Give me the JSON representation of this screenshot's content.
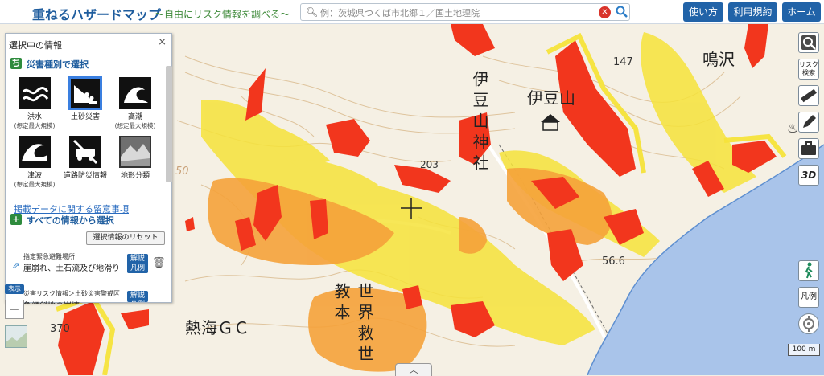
{
  "header": {
    "title": "重ねるハザードマップ",
    "subtitle": "～自由にリスク情報を調べる～",
    "search": {
      "placeholder": "例：茨城県つくば市北郷１／国土地理院",
      "clear_icon": "close-icon",
      "search_icon": "magnifier-icon"
    },
    "buttons": {
      "howto": "使い方",
      "terms": "利用規約",
      "home": "ホーム"
    }
  },
  "colors": {
    "brand": "#1f5d9e",
    "button": "#2163a8",
    "hazard_red": "#f2361d",
    "hazard_yellow": "#f6e33a",
    "hazard_orange": "#f5a23a",
    "sea": "#a9c4ea"
  },
  "panel": {
    "title": "選択中の情報",
    "close": "×",
    "by_type_header": "災害種別で選択",
    "hazards": [
      {
        "label": "洪水",
        "sub": "(想定最大規模)",
        "icon": "flood-icon",
        "selected": false
      },
      {
        "label": "土砂災害",
        "sub": "",
        "icon": "landslide-icon",
        "selected": true
      },
      {
        "label": "高潮",
        "sub": "(想定最大規模)",
        "icon": "storm-surge-icon",
        "selected": false
      },
      {
        "label": "津波",
        "sub": "(想定最大規模)",
        "icon": "tsunami-icon",
        "selected": false
      },
      {
        "label": "道路防災情報",
        "sub": "",
        "icon": "road-closed-icon",
        "selected": false
      },
      {
        "label": "地形分類",
        "sub": "",
        "icon": "terrain-icon",
        "selected": false
      }
    ],
    "notice_link": "掲載データに関する留意事項",
    "all_info_header": "すべての情報から選択",
    "reset_button": "選択情報のリセット",
    "layers": [
      {
        "category": "指定緊急避難場所",
        "name": "崖崩れ、土石流及び地滑り",
        "explain": "解説\n凡例"
      },
      {
        "category": "災害リスク情報＞土砂災害警戒区",
        "name": "急傾斜地の崩壊",
        "explain": "解説\n凡例"
      }
    ]
  },
  "map": {
    "labels": {
      "izusan": "伊豆山",
      "izusan_jinja": "伊豆山神社",
      "narusawa": "鳴沢",
      "atami_gc": "熱海ＧＣ",
      "sekai_kyusei": "世界救世教本",
      "spot_147": "147",
      "spot_370": "370",
      "contour_50": "50",
      "spot_56_6": "56.6",
      "spot_203": "203"
    },
    "toggle_label": "表示",
    "zoom_out": "−",
    "scale": "100 m"
  },
  "right_tools": [
    {
      "name": "layer-icon",
      "label": ""
    },
    {
      "name": "risk-search-icon",
      "label": "リスク検索"
    },
    {
      "name": "ruler-icon",
      "label": ""
    },
    {
      "name": "pencil-icon",
      "label": ""
    },
    {
      "name": "toolbox-icon",
      "label": ""
    },
    {
      "name": "three-d-icon",
      "label": "3D"
    },
    {
      "name": "pedestrian-icon",
      "label": ""
    },
    {
      "name": "legend-icon",
      "label": "凡例"
    },
    {
      "name": "locate-icon",
      "label": ""
    }
  ]
}
